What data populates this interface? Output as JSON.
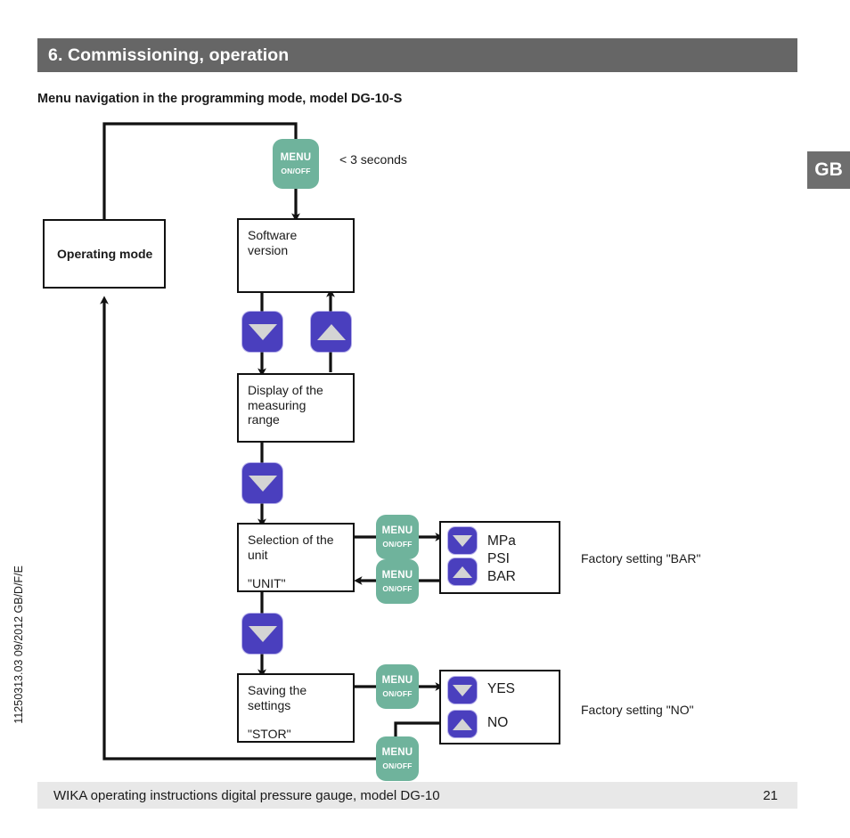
{
  "header": {
    "section_title": "6. Commissioning, operation",
    "bar_color": "#666666"
  },
  "subtitle": "Menu navigation in the programming mode, model DG-10-S",
  "language_badge": {
    "label": "GB",
    "color": "#6e6e6e"
  },
  "doc_code": "11250313.03 09/2012 GB/D/F/E",
  "footer": {
    "text": "WIKA operating instructions digital pressure gauge, model DG-10",
    "page": "21",
    "bar_color": "#e8e8e8"
  },
  "keys": {
    "menu_top": "MENU",
    "menu_bottom": "ON/OFF",
    "menu_color": "#6fb39c",
    "arrow_color": "#4a3fbe",
    "arrow_glyph_color": "#d4d4d4",
    "down_icon": "arrow-down-icon",
    "up_icon": "arrow-up-icon"
  },
  "annotations": {
    "timing": "< 3 seconds",
    "factory_unit": "Factory setting \"BAR\"",
    "factory_store": "Factory setting \"NO\""
  },
  "boxes": {
    "operating_mode": {
      "label": "Operating mode"
    },
    "software_version": {
      "line1": "Software",
      "line2": "version"
    },
    "measuring_range": {
      "line1": "Display of the",
      "line2": "measuring",
      "line3": "range"
    },
    "unit_selection": {
      "line1": "Selection of the",
      "line2": "unit",
      "code": "\"UNIT\""
    },
    "saving_settings": {
      "line1": "Saving the",
      "line2": "settings",
      "code": "\"STOR\""
    }
  },
  "options": {
    "unit": {
      "item1": "MPa",
      "item2": "PSI",
      "item3": "BAR"
    },
    "store": {
      "item1": "YES",
      "item2": "NO"
    }
  }
}
